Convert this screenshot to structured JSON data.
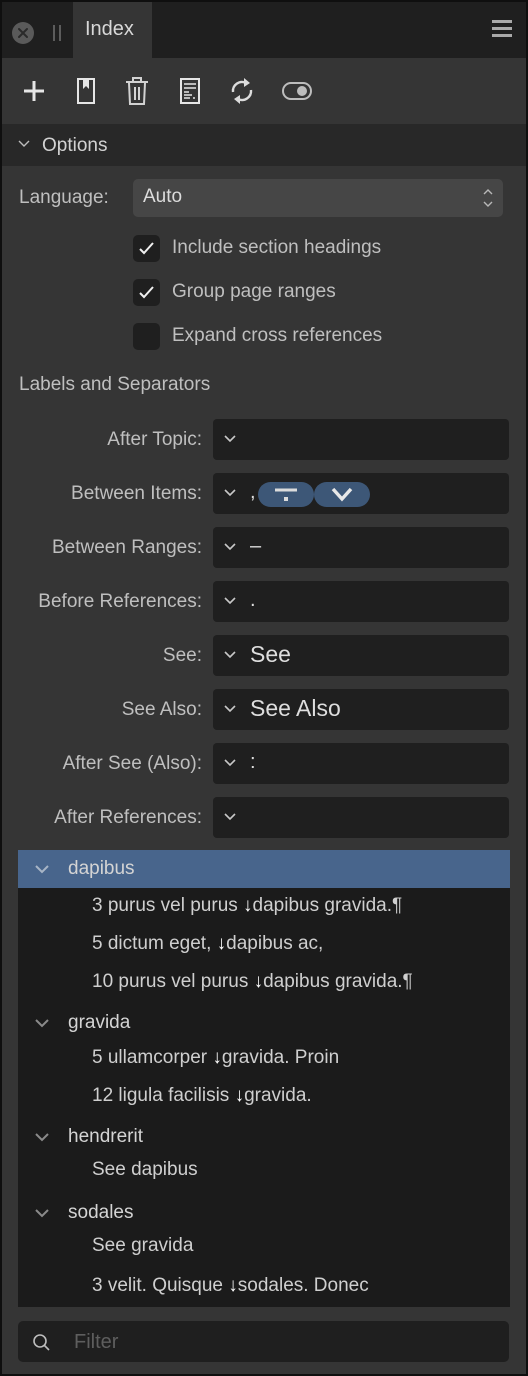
{
  "tabbar": {
    "close_icon": "close-circle-icon",
    "grip_icon": "drag-grip-icon",
    "tab_label": "Index",
    "menu_icon": "hamburger-menu-icon"
  },
  "toolbar": {
    "buttons": [
      {
        "name": "add",
        "icon": "plus-icon"
      },
      {
        "name": "insert-bookmark",
        "icon": "bookmark-page-icon"
      },
      {
        "name": "delete",
        "icon": "trash-icon"
      },
      {
        "name": "insert-index",
        "icon": "document-lines-icon"
      },
      {
        "name": "refresh",
        "icon": "refresh-icon"
      },
      {
        "name": "toggle-markers",
        "icon": "toggle-icon"
      }
    ]
  },
  "options": {
    "header": "Options",
    "language_label": "Language:",
    "language_value": "Auto",
    "checkboxes": [
      {
        "label": "Include section headings",
        "checked": true
      },
      {
        "label": "Group page ranges",
        "checked": true
      },
      {
        "label": "Expand cross references",
        "checked": false
      }
    ]
  },
  "separators": {
    "section_label": "Labels and Separators",
    "rows": [
      {
        "label": "After Topic:",
        "value": ""
      },
      {
        "label": "Between Items:",
        "value": ",",
        "tokens": [
          "tab-token",
          "newline-token"
        ]
      },
      {
        "label": "Between Ranges:",
        "value": "–"
      },
      {
        "label": "Before References:",
        "value": "."
      },
      {
        "label": "See:",
        "value": "See"
      },
      {
        "label": "See Also:",
        "value": "See Also"
      },
      {
        "label": "After See (Also):",
        "value": ":"
      },
      {
        "label": "After References:",
        "value": ""
      }
    ]
  },
  "index": {
    "topics": [
      {
        "name": "dapibus",
        "selected": true,
        "refs": [
          {
            "page": "3",
            "before": "purus vel purus",
            "arrow": "↓",
            "after": "dapibus gravida.¶"
          },
          {
            "page": "5",
            "before": "dictum eget,",
            "arrow": "↓",
            "after": "dapibus ac,"
          },
          {
            "page": "10",
            "before": "purus vel purus",
            "arrow": "↓",
            "after": "dapibus gravida.¶"
          }
        ]
      },
      {
        "name": "gravida",
        "selected": false,
        "refs": [
          {
            "page": "5",
            "before": "ullamcorper",
            "arrow": "↓",
            "after": "gravida. Proin"
          },
          {
            "page": "12",
            "before": "ligula facilisis",
            "arrow": "↓",
            "after": "gravida."
          }
        ]
      },
      {
        "name": "hendrerit",
        "selected": false,
        "see": "See dapibus"
      },
      {
        "name": "sodales",
        "selected": false,
        "see": "See gravida",
        "refs": [
          {
            "page": "3",
            "before": "velit. Quisque",
            "arrow": "↓",
            "after": "sodales. Donec"
          }
        ]
      }
    ]
  },
  "filter": {
    "placeholder": "Filter",
    "value": ""
  },
  "colors": {
    "selection": "#48658c",
    "token": "#3d5777",
    "panel": "#353535",
    "field": "#1f1f1f"
  }
}
